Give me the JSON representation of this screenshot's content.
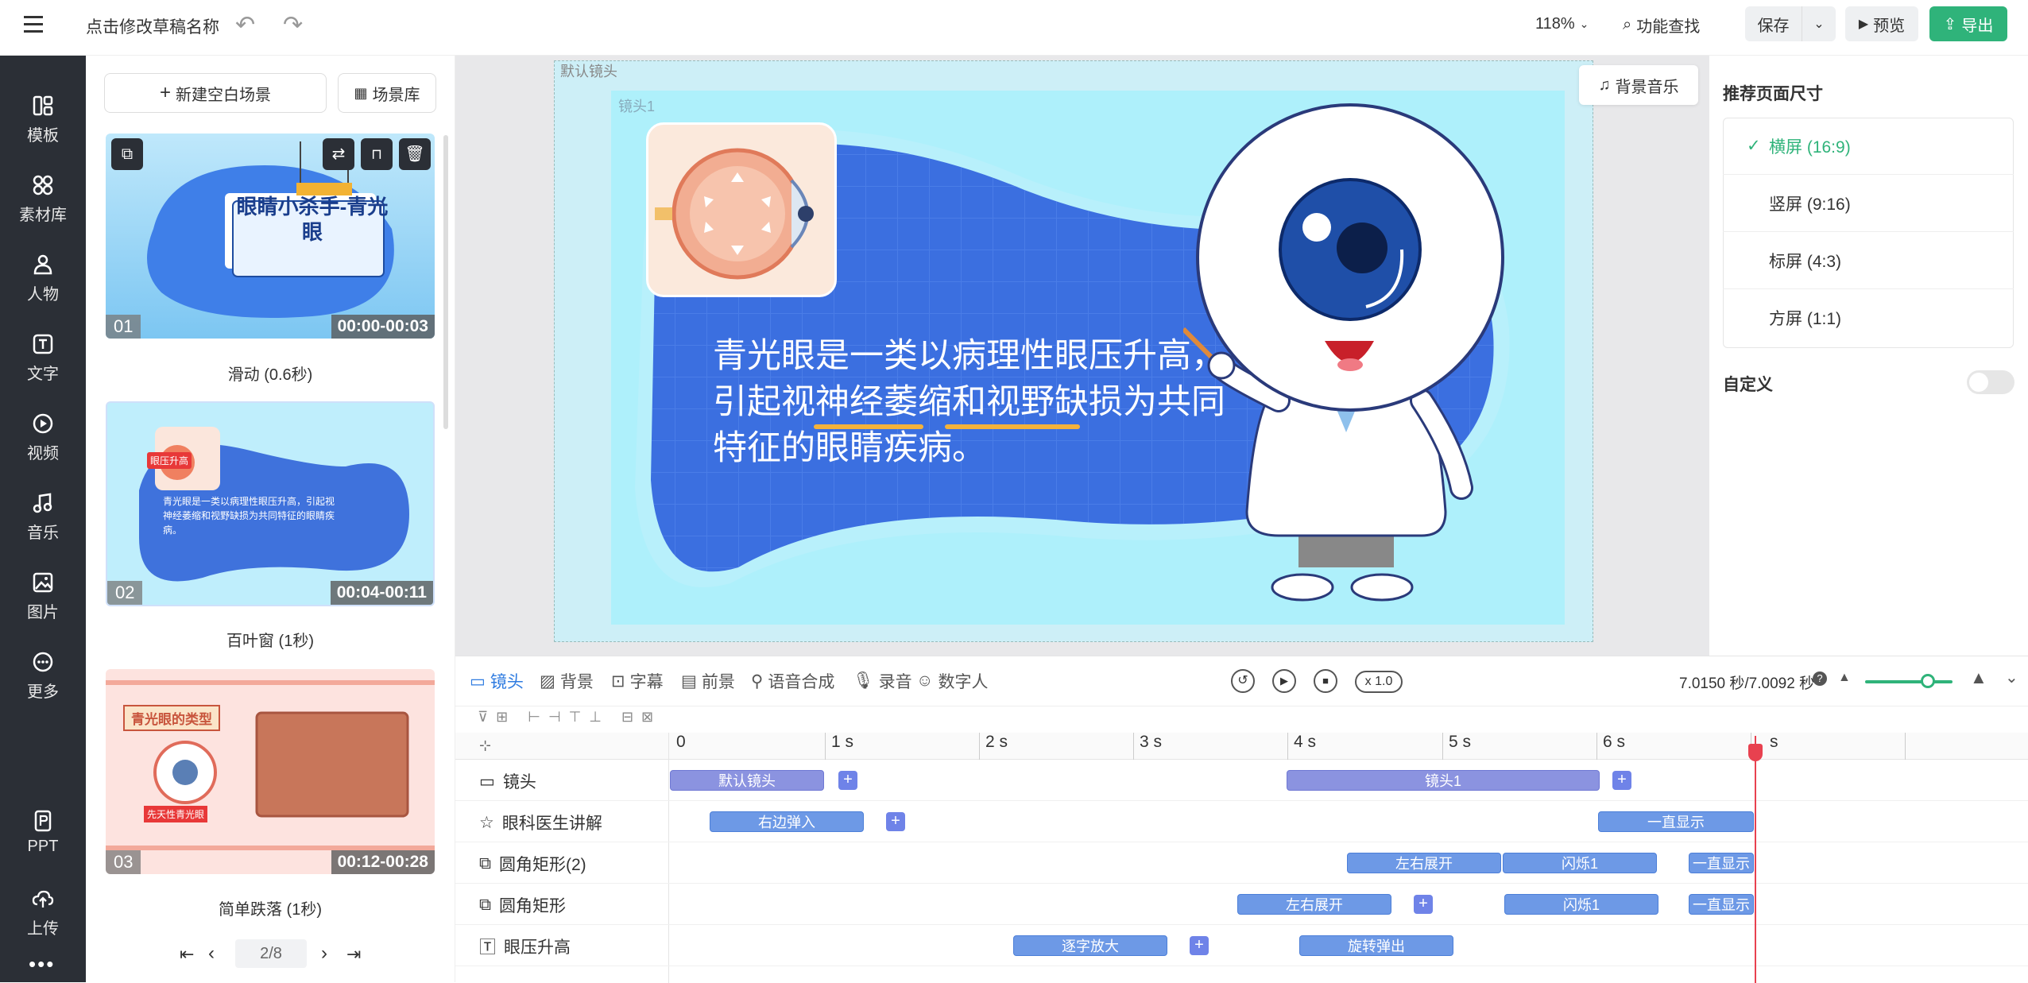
{
  "topbar": {
    "menu_icon": "hamburger-icon",
    "title": "点击修改草稿名称",
    "zoom": "118%",
    "find_label": "功能查找",
    "save_label": "保存",
    "preview_label": "预览",
    "export_label": "导出"
  },
  "colors": {
    "accent": "#2fb37a",
    "nav_bg": "#2b2f36",
    "clip_lens": "#8b93e0",
    "clip_anim": "#6d99e6",
    "playhead": "#e8414f"
  },
  "leftnav": {
    "items": [
      {
        "label": "模板",
        "icon": "template-icon"
      },
      {
        "label": "素材库",
        "icon": "materials-icon"
      },
      {
        "label": "人物",
        "icon": "person-icon"
      },
      {
        "label": "文字",
        "icon": "text-icon"
      },
      {
        "label": "视频",
        "icon": "video-icon"
      },
      {
        "label": "音乐",
        "icon": "music-icon"
      },
      {
        "label": "图片",
        "icon": "image-icon"
      },
      {
        "label": "更多",
        "icon": "more-icon"
      }
    ],
    "bottom": [
      {
        "label": "PPT",
        "icon": "ppt-icon"
      },
      {
        "label": "上传",
        "icon": "upload-icon"
      }
    ]
  },
  "scenes": {
    "new_scene_label": "新建空白场景",
    "library_label": "场景库",
    "items": [
      {
        "num": "01",
        "time": "00:00-00:03",
        "caption": "滑动 (0.6秒)",
        "thumb_title": "眼睛小杀手-青光眼"
      },
      {
        "num": "02",
        "time": "00:04-00:11",
        "caption": "百叶窗 (1秒)",
        "thumb_text": "青光眼是一类以病理性眼压升高，引起视神经萎缩和视野缺损为共同特征的眼睛疾病。",
        "thumb_badge": "眼压升高"
      },
      {
        "num": "03",
        "time": "00:12-00:28",
        "caption": "简单跌落 (1秒)",
        "thumb_title": "青光眼的类型",
        "thumb_badge": "先天性青光眼"
      }
    ],
    "pager": "2/8"
  },
  "canvas": {
    "default_lens_label": "默认镜头",
    "lens_label": "镜头1",
    "bg_music_label": "背景音乐",
    "main_text_line1": "青光眼是一类以病理性眼压升高，",
    "main_text_line2": "引起视神经萎缩和视野缺损为共同",
    "main_text_line3": "特征的眼睛疾病。"
  },
  "rightpanel": {
    "title": "推荐页面尺寸",
    "options": [
      "横屏 (16:9)",
      "竖屏 (9:16)",
      "标屏 (4:3)",
      "方屏 (1:1)"
    ],
    "selected": 0,
    "custom_label": "自定义"
  },
  "timeline": {
    "tabs": [
      "镜头",
      "背景",
      "字幕",
      "前景",
      "语音合成",
      "录音",
      "数字人"
    ],
    "speed": "x 1.0",
    "time_readout": "7.0150 秒/7.0092 秒",
    "ruler": [
      "0",
      "1 s",
      "2 s",
      "3 s",
      "4 s",
      "5 s",
      "6 s",
      "s"
    ],
    "tracks": [
      {
        "label": "镜头",
        "icon": "lens-icon",
        "clips": [
          {
            "text": "默认镜头",
            "style": "A"
          },
          {
            "text": "镜头1",
            "style": "A"
          }
        ]
      },
      {
        "label": "眼科医生讲解",
        "icon": "character-icon",
        "clips": [
          {
            "text": "右边弹入",
            "style": "B"
          },
          {
            "text": "一直显示",
            "style": "B"
          }
        ]
      },
      {
        "label": "圆角矩形(2)",
        "icon": "shape-icon",
        "clips": [
          {
            "text": "左右展开",
            "style": "B"
          },
          {
            "text": "闪烁1",
            "style": "B"
          },
          {
            "text": "一直显示",
            "style": "B"
          }
        ]
      },
      {
        "label": "圆角矩形",
        "icon": "shape-icon",
        "clips": [
          {
            "text": "左右展开",
            "style": "B"
          },
          {
            "text": "闪烁1",
            "style": "B"
          },
          {
            "text": "一直显示",
            "style": "B"
          }
        ]
      },
      {
        "label": "眼压升高",
        "icon": "text-track-icon",
        "clips": [
          {
            "text": "逐字放大",
            "style": "B"
          },
          {
            "text": "旋转弹出",
            "style": "B"
          }
        ]
      }
    ]
  }
}
